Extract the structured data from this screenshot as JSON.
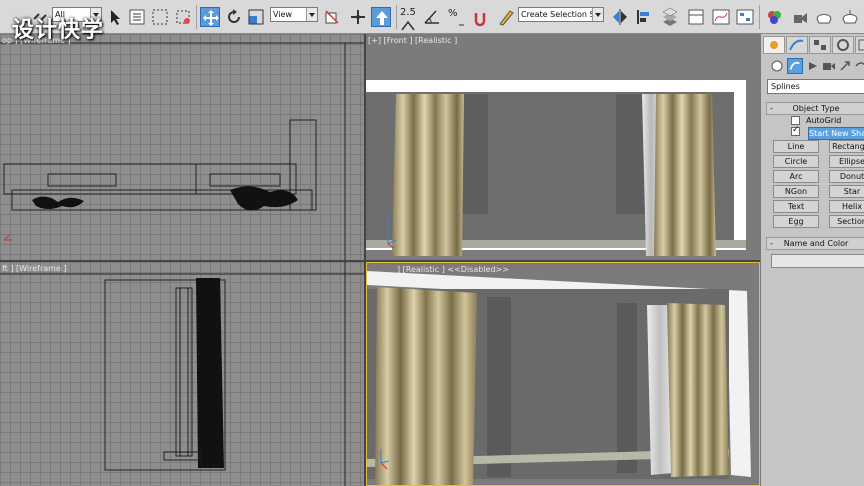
{
  "watermark": "设计快学",
  "toolbar": {
    "filter_select": "All",
    "ref_coord_select": "View",
    "angle_snap_value": "2.5",
    "percent_snap_symbol": "%",
    "selection_set_select": "Create Selection Se",
    "active_tool_color": "#5a9bd8"
  },
  "viewports": {
    "top": {
      "label": "op ] [Wireframe ]"
    },
    "front": {
      "label": "[+] [Front ] [Realistic ]"
    },
    "left": {
      "label": "ft ] [Wireframe ]"
    },
    "perspective": {
      "label": "] [Realistic ] <<Disabled>>"
    }
  },
  "command_panel": {
    "category_dropdown": "Splines",
    "object_type_title": "Object Type",
    "autogrid_label": "AutoGrid",
    "start_new_shape_label": "Start New Shape",
    "start_new_shape_checked": true,
    "buttons": [
      {
        "label": "Line"
      },
      {
        "label": "Rectangle"
      },
      {
        "label": "Circle"
      },
      {
        "label": "Ellipse"
      },
      {
        "label": "Arc"
      },
      {
        "label": "Donut"
      },
      {
        "label": "NGon"
      },
      {
        "label": "Star"
      },
      {
        "label": "Text"
      },
      {
        "label": "Helix"
      },
      {
        "label": "Egg"
      },
      {
        "label": "Section"
      }
    ],
    "name_color_title": "Name and Color",
    "name_value": ""
  }
}
